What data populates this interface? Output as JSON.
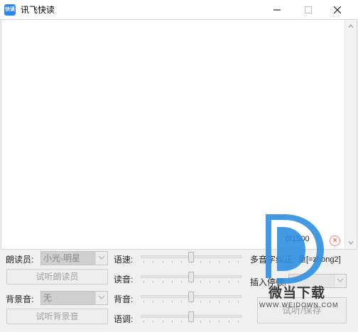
{
  "window": {
    "title": "讯飞快读",
    "icon_label": "快读",
    "icon_color": "#2f86e8"
  },
  "editor": {
    "content": "",
    "char_count": "0/1500"
  },
  "controls": {
    "reader_label": "朗读员:",
    "reader_value": "小光-明星",
    "listen_reader_button": "试听朗读员",
    "bgm_label": "背景音:",
    "bgm_value": "无",
    "listen_bgm_button": "试听背景音",
    "speed_label": "语速:",
    "volume_label": "读音:",
    "bg_volume_label": "背音:",
    "pitch_label": "语调:",
    "speed_level": 0.5,
    "volume_level": 0.5,
    "bg_volume_level": 0.5,
    "pitch_level": 0.5,
    "polyphone_label": "多音字纠正:",
    "polyphone_example": "重[=zhong2]",
    "insert_pause_label": "插入停顿:",
    "insert_pause_value": "",
    "listen_save_button": "试听/保存"
  },
  "watermark": {
    "name": "微当下载",
    "url": "WWW.WEIDOWN.COM",
    "color": "#2f8fe0"
  }
}
